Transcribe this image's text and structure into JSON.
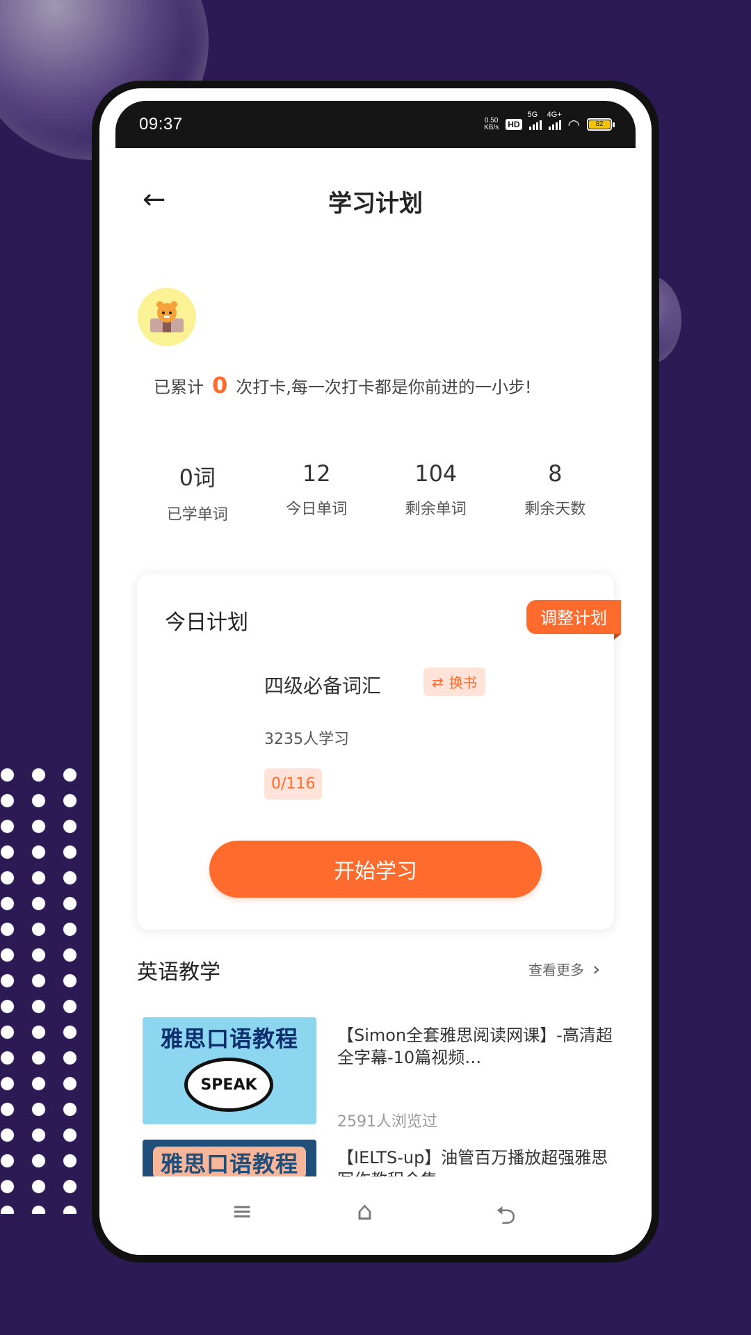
{
  "status_bar": {
    "time": "09:37",
    "net_speed_value": "0.50",
    "net_speed_unit": "KB/s",
    "hd_label": "HD",
    "signal1_label": "5G",
    "signal2_label": "4G+",
    "battery_level": "82"
  },
  "header": {
    "back_icon": "←",
    "title": "学习计划"
  },
  "checkin": {
    "prefix": "已累计",
    "count": "0",
    "suffix": "次打卡,每一次打卡都是你前进的一小步!"
  },
  "stats": [
    {
      "value": "0词",
      "label": "已学单词"
    },
    {
      "value": "12",
      "label": "今日单词"
    },
    {
      "value": "104",
      "label": "剩余单词"
    },
    {
      "value": "8",
      "label": "剩余天数"
    }
  ],
  "plan": {
    "title": "今日计划",
    "adjust_label": "调整计划",
    "book_name": "四级必备词汇",
    "swap_label": "换书",
    "learners": "3235人学习",
    "progress": "0/116",
    "start_label": "开始学习"
  },
  "section": {
    "title": "英语教学",
    "more_label": "查看更多"
  },
  "courses": [
    {
      "thumb_title": "雅思口语教程",
      "thumb_badge": "SPEAK",
      "title": "【Simon全套雅思阅读网课】-高清超全字幕-10篇视频…",
      "views": "2591人浏览过"
    },
    {
      "thumb_title": "雅思口语教程",
      "title": "【IELTS-up】油管百万播放超强雅思写作教程合集",
      "views": ""
    }
  ],
  "icons": {
    "back": "arrow-left-icon",
    "swap": "swap-icon",
    "chevron": "chevron-right-icon",
    "nav_menu": "menu-icon",
    "nav_home": "home-icon",
    "nav_back": "back-icon"
  },
  "colors": {
    "accent": "#ff6b2c",
    "background": "#2c1a55",
    "chip_bg": "#ffe3d8"
  }
}
